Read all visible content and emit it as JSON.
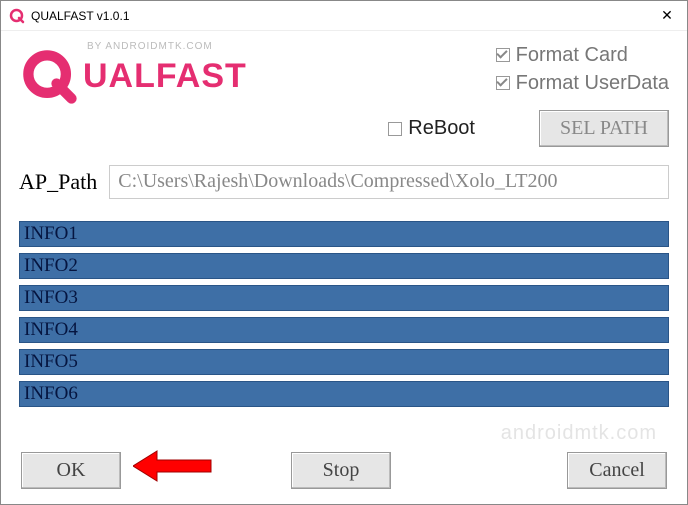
{
  "window": {
    "title": "QUALFAST v1.0.1"
  },
  "logo": {
    "byline": "BY ANDROIDMTK.COM",
    "wordmark": "UALFAST"
  },
  "options": {
    "format_card": {
      "label": "Format Card",
      "checked": true
    },
    "format_userdata": {
      "label": "Format UserData",
      "checked": true
    },
    "reboot": {
      "label": "ReBoot",
      "checked": false
    }
  },
  "buttons": {
    "sel_path": "SEL PATH",
    "ok": "OK",
    "stop": "Stop",
    "cancel": "Cancel"
  },
  "path": {
    "label": "AP_Path",
    "value": "C:\\Users\\Rajesh\\Downloads\\Compressed\\Xolo_LT200"
  },
  "info_items": [
    "INFO1",
    "INFO2",
    "INFO3",
    "INFO4",
    "INFO5",
    "INFO6"
  ],
  "watermark": "androidmtk.com",
  "colors": {
    "brand": "#e52e71",
    "info_bg": "#3e6fa6"
  }
}
